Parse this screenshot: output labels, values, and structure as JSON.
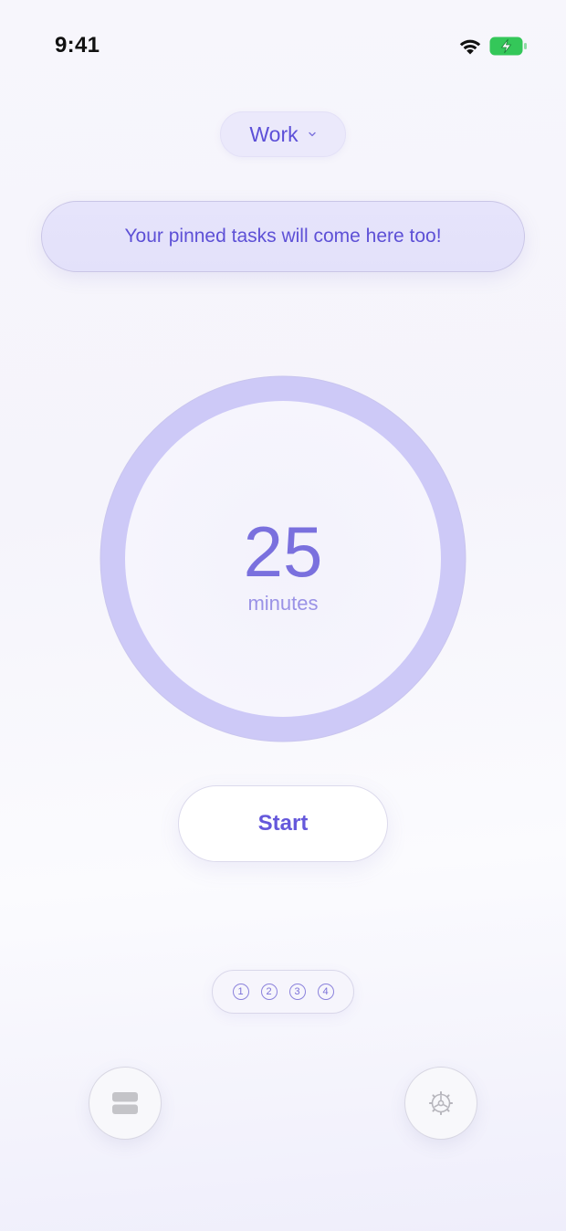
{
  "status_bar": {
    "time": "9:41"
  },
  "mode_selector": {
    "label": "Work"
  },
  "pinned_banner": {
    "text": "Your pinned tasks will come here too!"
  },
  "timer": {
    "value": "25",
    "unit": "minutes",
    "progress": 1.0
  },
  "start_button": {
    "label": "Start"
  },
  "sessions": {
    "items": [
      "1",
      "2",
      "3",
      "4"
    ]
  },
  "icons": {
    "tasks": "stacked-cards-icon",
    "settings": "gear-icon"
  },
  "colors": {
    "accent": "#5c4fd8",
    "ring": "#cdc9f7",
    "battery": "#34c759"
  }
}
